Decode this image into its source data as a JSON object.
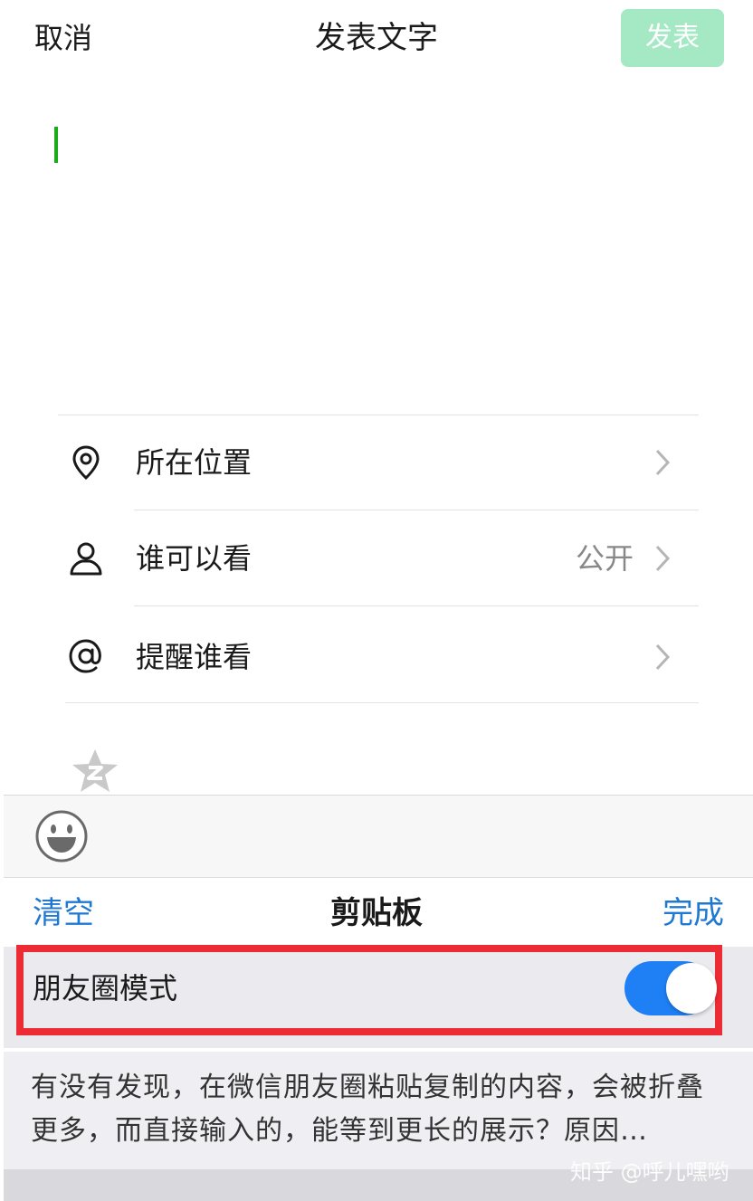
{
  "header": {
    "cancel_label": "取消",
    "title": "发表文字",
    "publish_label": "发表"
  },
  "options": {
    "location": {
      "label": "所在位置",
      "icon": "location-pin-icon"
    },
    "visibility": {
      "label": "谁可以看",
      "value": "公开",
      "icon": "person-icon"
    },
    "mention": {
      "label": "提醒谁看",
      "icon": "at-icon"
    }
  },
  "qzone_icon": "qzone-star-icon",
  "keyboard": {
    "emoji_icon": "smiley-icon",
    "clipboard": {
      "clear_label": "清空",
      "title": "剪贴板",
      "done_label": "完成",
      "mode_label": "朋友圈模式",
      "mode_enabled": true,
      "preview_text": "有没有发现，在微信朋友圈粘贴复制的内容，会被折叠更多，而直接输入的，能等到更长的展示？原因…"
    }
  },
  "watermark": "知乎 @呼儿嘿哟",
  "colors": {
    "publish_disabled": "#a4e8c4",
    "caret": "#1aad19",
    "link_blue": "#1f78d1",
    "toggle_on": "#1f80f5",
    "highlight_red": "#ec2b34"
  }
}
